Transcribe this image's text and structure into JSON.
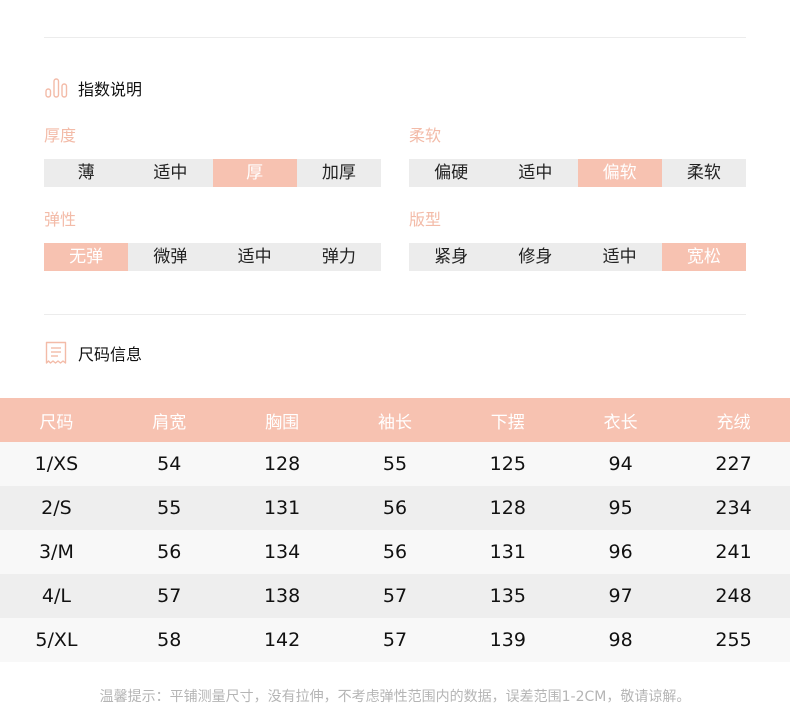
{
  "index_section": {
    "title": "指数说明",
    "groups": [
      {
        "title": "厚度",
        "options": [
          "薄",
          "适中",
          "厚",
          "加厚"
        ],
        "selected": 2
      },
      {
        "title": "柔软",
        "options": [
          "偏硬",
          "适中",
          "偏软",
          "柔软"
        ],
        "selected": 2
      },
      {
        "title": "弹性",
        "options": [
          "无弹",
          "微弹",
          "适中",
          "弹力"
        ],
        "selected": 0
      },
      {
        "title": "版型",
        "options": [
          "紧身",
          "修身",
          "适中",
          "宽松"
        ],
        "selected": 3
      }
    ]
  },
  "size_section": {
    "title": "尺码信息",
    "headers": [
      "尺码",
      "肩宽",
      "胸围",
      "袖长",
      "下摆",
      "衣长",
      "充绒"
    ],
    "rows": [
      [
        "1/XS",
        "54",
        "128",
        "55",
        "125",
        "94",
        "227"
      ],
      [
        "2/S",
        "55",
        "131",
        "56",
        "128",
        "95",
        "234"
      ],
      [
        "3/M",
        "56",
        "134",
        "56",
        "131",
        "96",
        "241"
      ],
      [
        "4/L",
        "57",
        "138",
        "57",
        "135",
        "97",
        "248"
      ],
      [
        "5/XL",
        "58",
        "142",
        "57",
        "139",
        "98",
        "255"
      ]
    ]
  },
  "note": "温馨提示：平铺测量尺寸，没有拉伸，不考虑弹性范围内的数据，误差范围1-2CM，敬请谅解。",
  "colors": {
    "accent": "#f7c2b1",
    "title_accent": "#f3bba8",
    "bar_bg": "#ececec"
  },
  "icons": {
    "index": "bar-chart-icon",
    "size": "receipt-icon"
  }
}
